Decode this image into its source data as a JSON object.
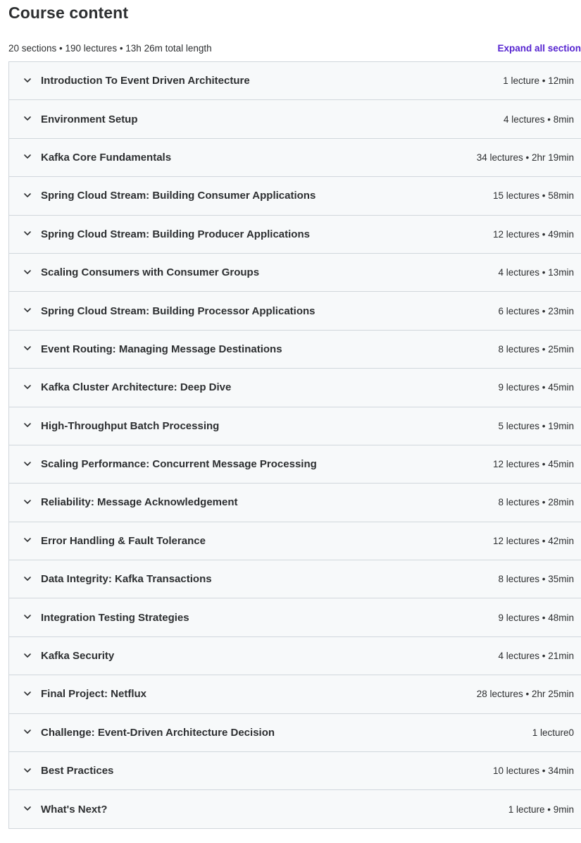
{
  "header": {
    "title": "Course content",
    "summary": "20 sections • 190 lectures • 13h 26m total length",
    "expand_label": "Expand all section"
  },
  "sections": [
    {
      "title": "Introduction To Event Driven Architecture",
      "meta": "1 lecture • 12min"
    },
    {
      "title": "Environment Setup",
      "meta": "4 lectures • 8min"
    },
    {
      "title": "Kafka Core Fundamentals",
      "meta": "34 lectures • 2hr 19min"
    },
    {
      "title": "Spring Cloud Stream: Building Consumer Applications",
      "meta": "15 lectures • 58min"
    },
    {
      "title": "Spring Cloud Stream: Building Producer Applications",
      "meta": "12 lectures • 49min"
    },
    {
      "title": "Scaling Consumers with Consumer Groups",
      "meta": "4 lectures • 13min"
    },
    {
      "title": "Spring Cloud Stream: Building Processor Applications",
      "meta": "6 lectures • 23min"
    },
    {
      "title": "Event Routing: Managing Message Destinations",
      "meta": "8 lectures • 25min"
    },
    {
      "title": "Kafka Cluster Architecture: Deep Dive",
      "meta": "9 lectures • 45min"
    },
    {
      "title": "High-Throughput Batch Processing",
      "meta": "5 lectures • 19min"
    },
    {
      "title": "Scaling Performance: Concurrent Message Processing",
      "meta": "12 lectures • 45min"
    },
    {
      "title": "Reliability: Message Acknowledgement",
      "meta": "8 lectures • 28min"
    },
    {
      "title": "Error Handling & Fault Tolerance",
      "meta": "12 lectures • 42min"
    },
    {
      "title": "Data Integrity: Kafka Transactions",
      "meta": "8 lectures • 35min"
    },
    {
      "title": "Integration Testing Strategies",
      "meta": "9 lectures • 48min"
    },
    {
      "title": "Kafka Security",
      "meta": "4 lectures • 21min"
    },
    {
      "title": "Final Project: Netflux",
      "meta": "28 lectures • 2hr 25min"
    },
    {
      "title": "Challenge: Event-Driven Architecture Decision",
      "meta": "1 lecture0"
    },
    {
      "title": "Best Practices",
      "meta": "10 lectures • 34min"
    },
    {
      "title": "What's Next?",
      "meta": "1 lecture • 9min"
    }
  ],
  "icons": {
    "expand_chevron": "chevron-down-icon"
  },
  "colors": {
    "accent": "#5624d0",
    "section_bg": "#f7f9fa",
    "border": "#d1d7dc",
    "text": "#2d2f31"
  }
}
